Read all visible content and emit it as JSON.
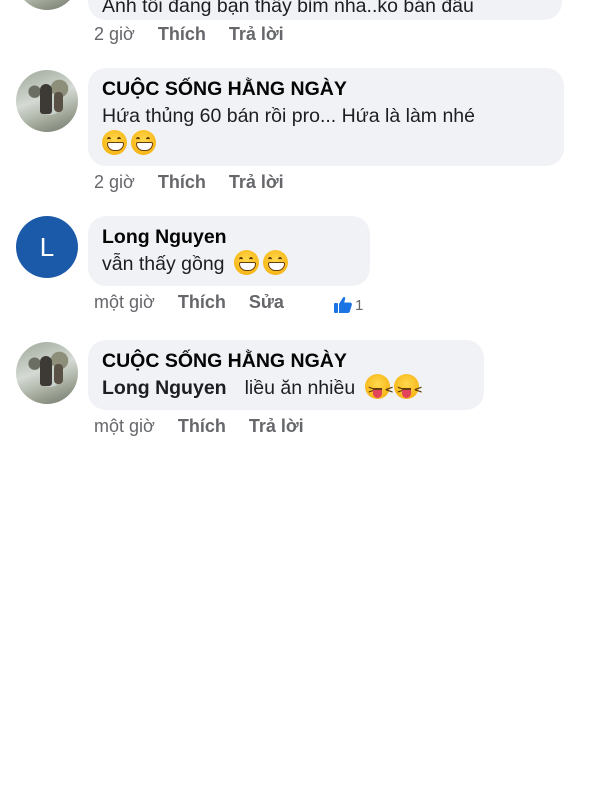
{
  "comments": [
    {
      "text": "Anh tôi đang bạn thấy bỉm nha..ko bán đâu",
      "time": "2 giờ",
      "like_label": "Thích",
      "reply_label": "Trả lời"
    },
    {
      "author": "CUỘC SỐNG HẰNG NGÀY",
      "text": "Hứa thủng 60 bán rồi pro... Hứa là làm nhé",
      "emojis": [
        "grinning-face",
        "grinning-face"
      ],
      "time": "2 giờ",
      "like_label": "Thích",
      "reply_label": "Trả lời"
    },
    {
      "avatar_letter": "L",
      "author": "Long Nguyen",
      "text": "vẫn thấy gồng",
      "emojis": [
        "grinning-face",
        "grinning-face"
      ],
      "time": "một giờ",
      "like_label": "Thích",
      "edit_label": "Sửa",
      "reaction_count": "1",
      "reaction_color": "#1b74e4"
    },
    {
      "author": "CUỘC SỐNG HẰNG NGÀY",
      "mention": "Long Nguyen",
      "text": "liều ăn nhiều",
      "emojis": [
        "squinting-face-with-tongue",
        "squinting-face-with-tongue"
      ],
      "time": "một giờ",
      "like_label": "Thích",
      "reply_label": "Trả lời"
    }
  ],
  "colors": {
    "bubble": "#f0f2f5",
    "avatar_letter_bg": "#1b5aa8",
    "meta_text": "#65676b"
  }
}
